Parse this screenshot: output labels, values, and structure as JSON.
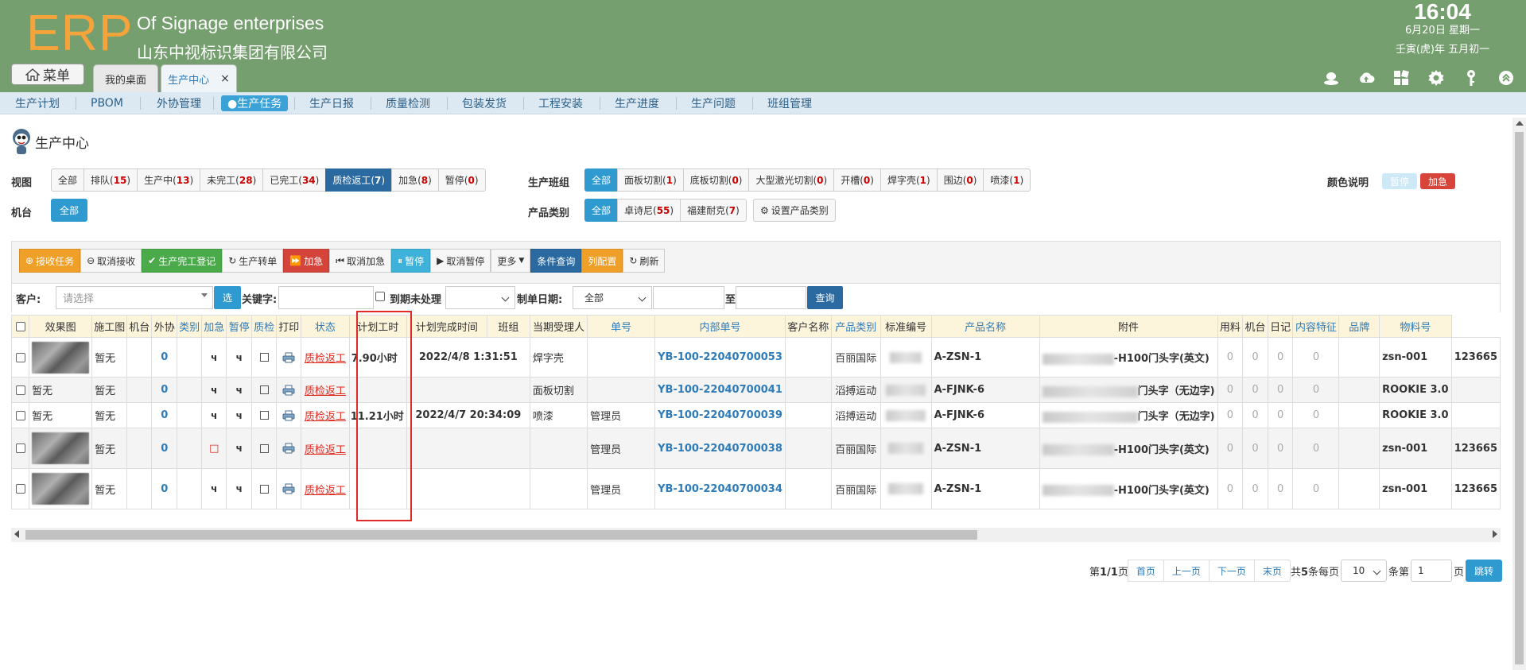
{
  "header": {
    "logo": "ERP",
    "company_en": "Of Signage enterprises",
    "company_cn": "山东中视标识集团有限公司",
    "time": "16:04",
    "date": "6月20日 星期一",
    "lunar": "壬寅(虎)年 五月初一",
    "menu_label": "菜单",
    "tabs": [
      {
        "label": "我的桌面"
      },
      {
        "label": "生产中心",
        "close": "×"
      }
    ],
    "icons": [
      "user-icon",
      "cloud-icon",
      "apps-icon",
      "gear-icon",
      "key-icon",
      "collapse-icon"
    ]
  },
  "nav": {
    "items": [
      "生产计划",
      "PBOM",
      "外协管理",
      "●生产任务",
      "生产日报",
      "质量检测",
      "包装发货",
      "工程安装",
      "生产进度",
      "生产问题",
      "班组管理"
    ]
  },
  "page_title": "生产中心",
  "filters": {
    "view_label": "视图",
    "view": [
      {
        "label": "全部",
        "count": ""
      },
      {
        "label": "排队(",
        "count": "15",
        "tail": ")"
      },
      {
        "label": "生产中(",
        "count": "13",
        "tail": ")"
      },
      {
        "label": "未完工(",
        "count": "28",
        "tail": ")"
      },
      {
        "label": "已完工(",
        "count": "34",
        "tail": ")"
      },
      {
        "label": "质检返工(",
        "count": "7",
        "tail": ")"
      },
      {
        "label": "加急(",
        "count": "8",
        "tail": ")"
      },
      {
        "label": "暂停(",
        "count": "0",
        "tail": ")"
      }
    ],
    "machine_label": "机台",
    "machine_all": "全部",
    "team_label": "生产班组",
    "team": [
      {
        "label": "全部",
        "count": ""
      },
      {
        "label": "面板切割(",
        "count": "1",
        "tail": ")"
      },
      {
        "label": "底板切割(",
        "count": "0",
        "tail": ")"
      },
      {
        "label": "大型激光切割(",
        "count": "0",
        "tail": ")"
      },
      {
        "label": "开槽(",
        "count": "0",
        "tail": ")"
      },
      {
        "label": "焊字壳(",
        "count": "1",
        "tail": ")"
      },
      {
        "label": "围边(",
        "count": "0",
        "tail": ")"
      },
      {
        "label": "喷漆(",
        "count": "1",
        "tail": ")"
      }
    ],
    "category_label": "产品类别",
    "category": [
      {
        "label": "全部",
        "count": ""
      },
      {
        "label": "卓诗尼(",
        "count": "55",
        "tail": ")"
      },
      {
        "label": "福建耐克(",
        "count": "7",
        "tail": ")"
      }
    ],
    "set_category": "设置产品类别",
    "legend_label": "颜色说明",
    "legend_pause": "暂停",
    "legend_urgent": "加急"
  },
  "toolbar": {
    "buttons": [
      {
        "label": "接收任务",
        "icon": "plus-circle-icon"
      },
      {
        "label": "取消接收",
        "icon": "minus-circle-icon"
      },
      {
        "label": "生产完工登记",
        "icon": "check-circle-icon"
      },
      {
        "label": "生产转单",
        "icon": "refresh-icon"
      },
      {
        "label": "加急",
        "icon": "fast-forward-icon"
      },
      {
        "label": "取消加急",
        "icon": "fast-backward-icon"
      },
      {
        "label": "暂停",
        "icon": "pause-icon"
      },
      {
        "label": "取消暂停",
        "icon": "play-icon"
      },
      {
        "label": "更多",
        "icon": "caret-down-icon"
      },
      {
        "label": "条件查询",
        "icon": ""
      },
      {
        "label": "列配置",
        "icon": ""
      },
      {
        "label": "刷新",
        "icon": "refresh-icon"
      }
    ]
  },
  "search": {
    "customer_label": "客户:",
    "customer_placeholder": "请选择",
    "select_btn": "选",
    "keyword_label": "关键字:",
    "overdue_label": "到期未处理",
    "date_label": "制单日期:",
    "date_range": "全部",
    "to_label": "至",
    "query_btn": "查询"
  },
  "table": {
    "columns": [
      "效果图",
      "施工图",
      "机台",
      "外协",
      "类别",
      "加急",
      "暂停",
      "质检",
      "打印",
      "状态",
      "计划工时",
      "计划完成时间",
      "班组",
      "当期受理人",
      "单号",
      "内部单号",
      "客户名称",
      "产品类别",
      "标准编号",
      "产品名称",
      "附件",
      "用料",
      "机台",
      "日记",
      "内容特征",
      "品牌",
      "物料号"
    ],
    "rows": [
      {
        "effect": "",
        "drawing": "暂无",
        "waixie": "0",
        "urgent": "ч",
        "pause": "ч",
        "status": "质检返工",
        "hours": "7.90小时",
        "finish": "2022/4/8 1:31:51",
        "team": "焊字壳",
        "handler": "",
        "order": "YB-100-22040700053",
        "customer": "百丽国际",
        "std": "A-ZSN-1",
        "product": "-H100门头字(英文)",
        "a1": "0",
        "a2": "0",
        "a3": "0",
        "a4": "0",
        "brand": "zsn-001",
        "material": "123665"
      },
      {
        "effect": "暂无",
        "drawing": "暂无",
        "waixie": "0",
        "urgent": "ч",
        "pause": "ч",
        "status": "质检返工",
        "hours": "",
        "finish": "",
        "team": "面板切割",
        "handler": "",
        "order": "YB-100-22040700041",
        "customer": "滔搏运动",
        "std": "A-FJNK-6",
        "product": "门头字（无边字)",
        "a1": "0",
        "a2": "0",
        "a3": "0",
        "a4": "0",
        "brand": "ROOKIE 3.0",
        "material": ""
      },
      {
        "effect": "暂无",
        "drawing": "暂无",
        "waixie": "0",
        "urgent": "ч",
        "pause": "ч",
        "status": "质检返工",
        "hours": "11.21小时",
        "finish": "2022/4/7 20:34:09",
        "team": "喷漆",
        "handler": "管理员",
        "order": "YB-100-22040700039",
        "customer": "滔搏运动",
        "std": "A-FJNK-6",
        "product": "门头字（无边字)",
        "a1": "0",
        "a2": "0",
        "a3": "0",
        "a4": "0",
        "brand": "ROOKIE 3.0",
        "material": ""
      },
      {
        "effect": "",
        "drawing": "暂无",
        "waixie": "0",
        "urgent": "□",
        "pause": "ч",
        "status": "质检返工",
        "hours": "",
        "finish": "",
        "team": "",
        "handler": "管理员",
        "order": "YB-100-22040700038",
        "customer": "百丽国际",
        "std": "A-ZSN-1",
        "product": "-H100门头字(英文)",
        "a1": "0",
        "a2": "0",
        "a3": "0",
        "a4": "0",
        "brand": "zsn-001",
        "material": "123665"
      },
      {
        "effect": "",
        "drawing": "暂无",
        "waixie": "0",
        "urgent": "ч",
        "pause": "ч",
        "status": "质检返工",
        "hours": "",
        "finish": "",
        "team": "",
        "handler": "管理员",
        "order": "YB-100-22040700034",
        "customer": "百丽国际",
        "std": "A-ZSN-1",
        "product": "-H100门头字(英文)",
        "a1": "0",
        "a2": "0",
        "a3": "0",
        "a4": "0",
        "brand": "zsn-001",
        "material": "123665"
      }
    ]
  },
  "pager": {
    "page_info_a": "第",
    "page_info_b": "1/1",
    "page_info_c": "页",
    "first": "首页",
    "prev": "上一页",
    "next": "下一页",
    "last": "末页",
    "total_a": "共",
    "total_b": "5",
    "total_c": "条每页",
    "page_size": "10",
    "goto_a": "条第",
    "goto_value": "1",
    "goto_b": "页",
    "jump": "跳转"
  },
  "colors": {
    "header_bg": "#769f6f",
    "logo": "#f5a33b",
    "accent_blue": "#2e9ad0",
    "status_red": "#e0261b",
    "link_blue": "#2e7bb8"
  }
}
